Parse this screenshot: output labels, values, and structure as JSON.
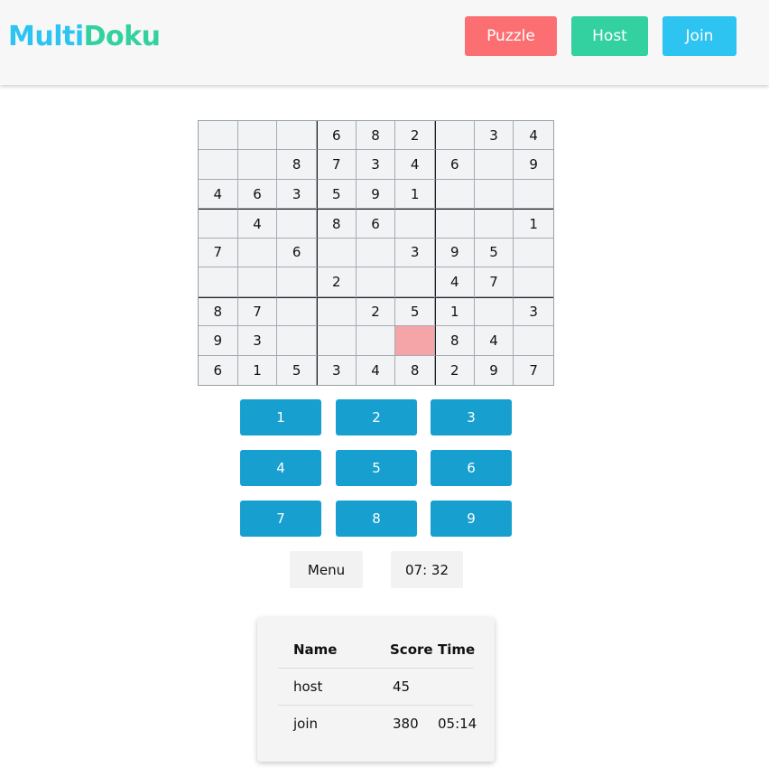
{
  "app": {
    "logo_part1": "Multi",
    "logo_part2": "Doku"
  },
  "nav": {
    "puzzle_label": "Puzzle",
    "host_label": "Host",
    "join_label": "Join"
  },
  "board": {
    "rows": [
      [
        "",
        "",
        "",
        "6",
        "8",
        "2",
        "",
        "3",
        "4"
      ],
      [
        "",
        "",
        "8",
        "7",
        "3",
        "4",
        "6",
        "",
        "9"
      ],
      [
        "4",
        "6",
        "3",
        "5",
        "9",
        "1",
        "",
        "",
        ""
      ],
      [
        "",
        "4",
        "",
        "8",
        "6",
        "",
        "",
        "",
        "1"
      ],
      [
        "7",
        "",
        "6",
        "",
        "",
        "3",
        "9",
        "5",
        ""
      ],
      [
        "",
        "",
        "",
        "2",
        "",
        "",
        "4",
        "7",
        ""
      ],
      [
        "8",
        "7",
        "",
        "",
        "2",
        "5",
        "1",
        "",
        "3"
      ],
      [
        "9",
        "3",
        "",
        "",
        "",
        "",
        "8",
        "4",
        ""
      ],
      [
        "6",
        "1",
        "5",
        "3",
        "4",
        "8",
        "2",
        "9",
        "7"
      ]
    ],
    "selected_cell": {
      "row": 7,
      "col": 5
    }
  },
  "numpad": {
    "keys": [
      "1",
      "2",
      "3",
      "4",
      "5",
      "6",
      "7",
      "8",
      "9"
    ]
  },
  "controls": {
    "menu_label": "Menu",
    "timer": "07: 32"
  },
  "scoreboard": {
    "headers": {
      "name": "Name",
      "score": "Score",
      "time": "Time"
    },
    "rows": [
      {
        "name": "host",
        "score": "45",
        "time": ""
      },
      {
        "name": "join",
        "score": "380",
        "time": "05:14"
      }
    ]
  },
  "colors": {
    "header_bg": "#f7f7f7",
    "logo_multi": "#2ec4f1",
    "logo_doku": "#33d1a0",
    "puzzle_btn": "#fb6f72",
    "host_btn": "#33d1a0",
    "join_btn": "#2ec4f1",
    "numpad_btn": "#169fcf",
    "cell_bg": "#f2f3f5",
    "selected_cell": "#f5a5a7"
  }
}
